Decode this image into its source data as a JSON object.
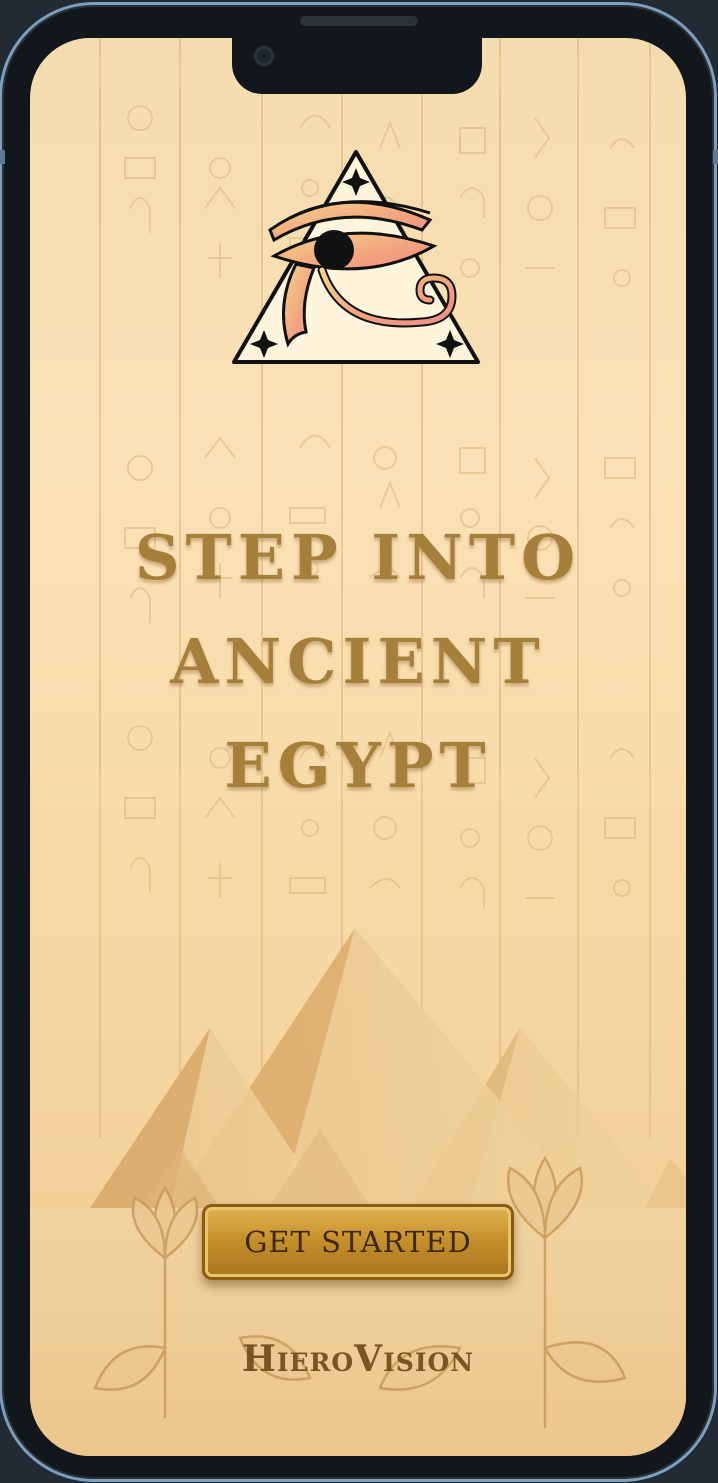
{
  "app": {
    "name": "HieroVision"
  },
  "hero": {
    "headline_line1": "STEP INTO",
    "headline_line2": "ANCIENT",
    "headline_line3": "EGYPT"
  },
  "cta": {
    "label": "GET STARTED"
  },
  "colors": {
    "background_top": "#f4dcae",
    "background_bottom": "#f0c98e",
    "headline": "#a67f3a",
    "button_gold": "#c48e2a",
    "brand_text": "#7a5524",
    "logo_gradient_start": "#f3c86a",
    "logo_gradient_end": "#f08a7a"
  },
  "icons": {
    "logo": "eye-of-horus-triangle-icon",
    "background": "hieroglyph-pattern",
    "scenery": "pyramids-and-lotus"
  }
}
